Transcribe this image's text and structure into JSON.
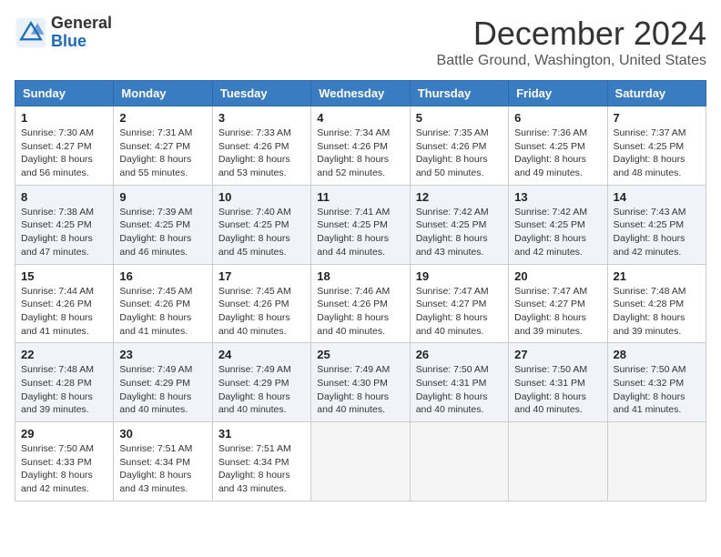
{
  "header": {
    "logo_general": "General",
    "logo_blue": "Blue",
    "month_title": "December 2024",
    "location": "Battle Ground, Washington, United States"
  },
  "days_of_week": [
    "Sunday",
    "Monday",
    "Tuesday",
    "Wednesday",
    "Thursday",
    "Friday",
    "Saturday"
  ],
  "weeks": [
    [
      {
        "day": "1",
        "sunrise": "7:30 AM",
        "sunset": "4:27 PM",
        "daylight": "8 hours and 56 minutes."
      },
      {
        "day": "2",
        "sunrise": "7:31 AM",
        "sunset": "4:27 PM",
        "daylight": "8 hours and 55 minutes."
      },
      {
        "day": "3",
        "sunrise": "7:33 AM",
        "sunset": "4:26 PM",
        "daylight": "8 hours and 53 minutes."
      },
      {
        "day": "4",
        "sunrise": "7:34 AM",
        "sunset": "4:26 PM",
        "daylight": "8 hours and 52 minutes."
      },
      {
        "day": "5",
        "sunrise": "7:35 AM",
        "sunset": "4:26 PM",
        "daylight": "8 hours and 50 minutes."
      },
      {
        "day": "6",
        "sunrise": "7:36 AM",
        "sunset": "4:25 PM",
        "daylight": "8 hours and 49 minutes."
      },
      {
        "day": "7",
        "sunrise": "7:37 AM",
        "sunset": "4:25 PM",
        "daylight": "8 hours and 48 minutes."
      }
    ],
    [
      {
        "day": "8",
        "sunrise": "7:38 AM",
        "sunset": "4:25 PM",
        "daylight": "8 hours and 47 minutes."
      },
      {
        "day": "9",
        "sunrise": "7:39 AM",
        "sunset": "4:25 PM",
        "daylight": "8 hours and 46 minutes."
      },
      {
        "day": "10",
        "sunrise": "7:40 AM",
        "sunset": "4:25 PM",
        "daylight": "8 hours and 45 minutes."
      },
      {
        "day": "11",
        "sunrise": "7:41 AM",
        "sunset": "4:25 PM",
        "daylight": "8 hours and 44 minutes."
      },
      {
        "day": "12",
        "sunrise": "7:42 AM",
        "sunset": "4:25 PM",
        "daylight": "8 hours and 43 minutes."
      },
      {
        "day": "13",
        "sunrise": "7:42 AM",
        "sunset": "4:25 PM",
        "daylight": "8 hours and 42 minutes."
      },
      {
        "day": "14",
        "sunrise": "7:43 AM",
        "sunset": "4:25 PM",
        "daylight": "8 hours and 42 minutes."
      }
    ],
    [
      {
        "day": "15",
        "sunrise": "7:44 AM",
        "sunset": "4:26 PM",
        "daylight": "8 hours and 41 minutes."
      },
      {
        "day": "16",
        "sunrise": "7:45 AM",
        "sunset": "4:26 PM",
        "daylight": "8 hours and 41 minutes."
      },
      {
        "day": "17",
        "sunrise": "7:45 AM",
        "sunset": "4:26 PM",
        "daylight": "8 hours and 40 minutes."
      },
      {
        "day": "18",
        "sunrise": "7:46 AM",
        "sunset": "4:26 PM",
        "daylight": "8 hours and 40 minutes."
      },
      {
        "day": "19",
        "sunrise": "7:47 AM",
        "sunset": "4:27 PM",
        "daylight": "8 hours and 40 minutes."
      },
      {
        "day": "20",
        "sunrise": "7:47 AM",
        "sunset": "4:27 PM",
        "daylight": "8 hours and 39 minutes."
      },
      {
        "day": "21",
        "sunrise": "7:48 AM",
        "sunset": "4:28 PM",
        "daylight": "8 hours and 39 minutes."
      }
    ],
    [
      {
        "day": "22",
        "sunrise": "7:48 AM",
        "sunset": "4:28 PM",
        "daylight": "8 hours and 39 minutes."
      },
      {
        "day": "23",
        "sunrise": "7:49 AM",
        "sunset": "4:29 PM",
        "daylight": "8 hours and 40 minutes."
      },
      {
        "day": "24",
        "sunrise": "7:49 AM",
        "sunset": "4:29 PM",
        "daylight": "8 hours and 40 minutes."
      },
      {
        "day": "25",
        "sunrise": "7:49 AM",
        "sunset": "4:30 PM",
        "daylight": "8 hours and 40 minutes."
      },
      {
        "day": "26",
        "sunrise": "7:50 AM",
        "sunset": "4:31 PM",
        "daylight": "8 hours and 40 minutes."
      },
      {
        "day": "27",
        "sunrise": "7:50 AM",
        "sunset": "4:31 PM",
        "daylight": "8 hours and 40 minutes."
      },
      {
        "day": "28",
        "sunrise": "7:50 AM",
        "sunset": "4:32 PM",
        "daylight": "8 hours and 41 minutes."
      }
    ],
    [
      {
        "day": "29",
        "sunrise": "7:50 AM",
        "sunset": "4:33 PM",
        "daylight": "8 hours and 42 minutes."
      },
      {
        "day": "30",
        "sunrise": "7:51 AM",
        "sunset": "4:34 PM",
        "daylight": "8 hours and 43 minutes."
      },
      {
        "day": "31",
        "sunrise": "7:51 AM",
        "sunset": "4:34 PM",
        "daylight": "8 hours and 43 minutes."
      },
      null,
      null,
      null,
      null
    ]
  ],
  "labels": {
    "sunrise": "Sunrise:",
    "sunset": "Sunset:",
    "daylight": "Daylight:"
  }
}
